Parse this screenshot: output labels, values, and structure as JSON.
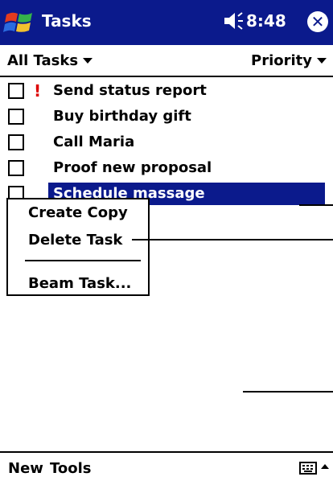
{
  "titlebar": {
    "title": "Tasks",
    "time": "8:48",
    "close_glyph": "✕",
    "icons": [
      "windows-start-icon",
      "speaker-icon",
      "close-icon"
    ]
  },
  "filterbar": {
    "filter_label": "All Tasks",
    "sort_label": "Priority"
  },
  "tasks": [
    {
      "label": "Send status report",
      "priority": "!",
      "high_priority": true,
      "selected": false
    },
    {
      "label": "Buy birthday gift",
      "priority": "",
      "high_priority": false,
      "selected": false
    },
    {
      "label": "Call Maria",
      "priority": "",
      "high_priority": false,
      "selected": false
    },
    {
      "label": "Proof new proposal",
      "priority": "",
      "high_priority": false,
      "selected": false
    },
    {
      "label": "Schedule massage",
      "priority": "!",
      "high_priority": true,
      "selected": true
    }
  ],
  "context_menu": {
    "items": [
      "Create Copy",
      "Delete Task",
      "Beam Task..."
    ]
  },
  "bottombar": {
    "menu_new": "New",
    "menu_tools": "Tools",
    "icons": [
      "keyboard-icon",
      "sip-up-arrow-icon"
    ]
  },
  "colors": {
    "titlebar_bg": "#0b1a8c",
    "selection_bg": "#0b1a8c",
    "priority_mark": "#dd0000"
  }
}
